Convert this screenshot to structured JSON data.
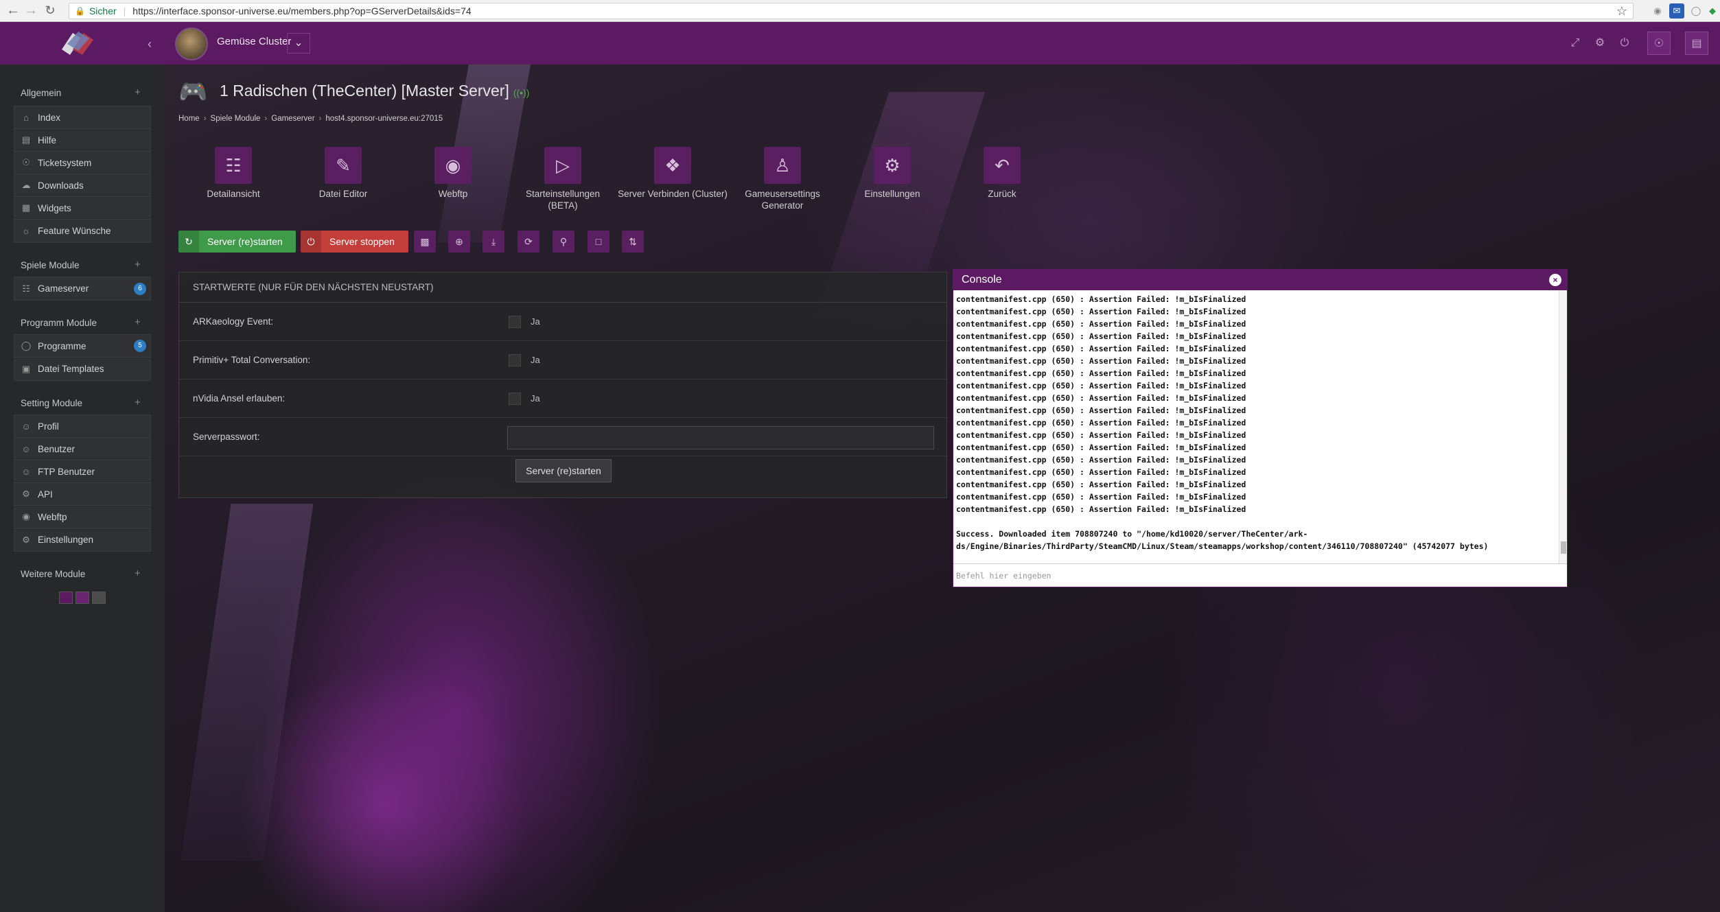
{
  "browser": {
    "secure_label": "Sicher",
    "url": "https://interface.sponsor-universe.eu/members.php?op=GServerDetails&ids=74"
  },
  "header": {
    "cluster_name": "Gemüse Cluster"
  },
  "sidebar": {
    "sections": [
      {
        "title": "Allgemein",
        "items": [
          {
            "label": "Index",
            "icon": "home-icon"
          },
          {
            "label": "Hilfe",
            "icon": "book-icon"
          },
          {
            "label": "Ticketsystem",
            "icon": "support-icon"
          },
          {
            "label": "Downloads",
            "icon": "cloud-download-icon"
          },
          {
            "label": "Widgets",
            "icon": "puzzle-icon"
          },
          {
            "label": "Feature Wünsche",
            "icon": "lightbulb-icon"
          }
        ]
      },
      {
        "title": "Spiele Module",
        "items": [
          {
            "label": "Gameserver",
            "icon": "gamepad-icon",
            "badge": "6"
          }
        ]
      },
      {
        "title": "Programm Module",
        "items": [
          {
            "label": "Programme",
            "icon": "lock-icon",
            "badge": "5"
          },
          {
            "label": "Datei Templates",
            "icon": "save-icon"
          }
        ]
      },
      {
        "title": "Setting Module",
        "items": [
          {
            "label": "Profil",
            "icon": "user-lock-icon"
          },
          {
            "label": "Benutzer",
            "icon": "user-icon"
          },
          {
            "label": "FTP Benutzer",
            "icon": "user-ftp-icon"
          },
          {
            "label": "API",
            "icon": "api-icon"
          },
          {
            "label": "Webftp",
            "icon": "globe-icon"
          },
          {
            "label": "Einstellungen",
            "icon": "gear-icon"
          }
        ]
      },
      {
        "title": "Weitere Module",
        "items": []
      }
    ],
    "swatch_colors": [
      "#5c1a63",
      "#6a2472",
      "#4b4b4b"
    ]
  },
  "page": {
    "title": "1 Radischen (TheCenter) [Master Server]",
    "breadcrumb": [
      "Home",
      "Spiele Module",
      "Gameserver",
      "host4.sponsor-universe.eu:27015"
    ]
  },
  "tiles": [
    {
      "label": "Detailansicht",
      "icon": "gamepad-icon"
    },
    {
      "label": "Datei Editor",
      "icon": "pencil-icon"
    },
    {
      "label": "Webftp",
      "icon": "globe-icon"
    },
    {
      "label": "Starteinstellungen (BETA)",
      "icon": "play-icon"
    },
    {
      "label": "Server Verbinden (Cluster)",
      "icon": "network-icon"
    },
    {
      "label": "Gameusersettings Generator",
      "icon": "person-icon"
    },
    {
      "label": "Einstellungen",
      "icon": "gears-icon"
    },
    {
      "label": "Zurück",
      "icon": "undo-icon"
    }
  ],
  "actions": {
    "restart_label": "Server (re)starten",
    "stop_label": "Server stoppen",
    "icon_buttons": [
      "terminal-icon",
      "plus-circle-icon",
      "download-icon",
      "refresh-icon",
      "key-icon",
      "file-icon",
      "sync-icon"
    ]
  },
  "form": {
    "heading": "STARTWERTE (NUR FÜR DEN NÄCHSTEN NEUSTART)",
    "fields": [
      {
        "label": "ARKaeology Event:",
        "option": "Ja",
        "checked": false
      },
      {
        "label": "Primitiv+ Total Conversation:",
        "option": "Ja",
        "checked": false
      },
      {
        "label": "nVidia Ansel erlauben:",
        "option": "Ja",
        "checked": false
      }
    ],
    "password_label": "Serverpasswort:",
    "password_value": "",
    "submit_label": "Server (re)starten"
  },
  "console": {
    "title": "Console",
    "lines": [
      "contentmanifest.cpp (650) : Assertion Failed: !m_bIsFinalized",
      "contentmanifest.cpp (650) : Assertion Failed: !m_bIsFinalized",
      "contentmanifest.cpp (650) : Assertion Failed: !m_bIsFinalized",
      "contentmanifest.cpp (650) : Assertion Failed: !m_bIsFinalized",
      "contentmanifest.cpp (650) : Assertion Failed: !m_bIsFinalized",
      "contentmanifest.cpp (650) : Assertion Failed: !m_bIsFinalized",
      "contentmanifest.cpp (650) : Assertion Failed: !m_bIsFinalized",
      "contentmanifest.cpp (650) : Assertion Failed: !m_bIsFinalized",
      "contentmanifest.cpp (650) : Assertion Failed: !m_bIsFinalized",
      "contentmanifest.cpp (650) : Assertion Failed: !m_bIsFinalized",
      "contentmanifest.cpp (650) : Assertion Failed: !m_bIsFinalized",
      "contentmanifest.cpp (650) : Assertion Failed: !m_bIsFinalized",
      "contentmanifest.cpp (650) : Assertion Failed: !m_bIsFinalized",
      "contentmanifest.cpp (650) : Assertion Failed: !m_bIsFinalized",
      "contentmanifest.cpp (650) : Assertion Failed: !m_bIsFinalized",
      "contentmanifest.cpp (650) : Assertion Failed: !m_bIsFinalized",
      "contentmanifest.cpp (650) : Assertion Failed: !m_bIsFinalized",
      "contentmanifest.cpp (650) : Assertion Failed: !m_bIsFinalized"
    ],
    "success_line1": "Success. Downloaded item 708807240 to \"/home/kd10020/server/TheCenter/ark-",
    "success_line2": "ds/Engine/Binaries/ThirdParty/SteamCMD/Linux/Steam/steamapps/workshop/content/346110/708807240\" (45742077 bytes)",
    "input_placeholder": "Befehl hier eingeben"
  },
  "colors": {
    "brand": "#5c1a63",
    "success": "#3f9a4a",
    "danger": "#c33e3a",
    "badge": "#2d7ec4"
  }
}
